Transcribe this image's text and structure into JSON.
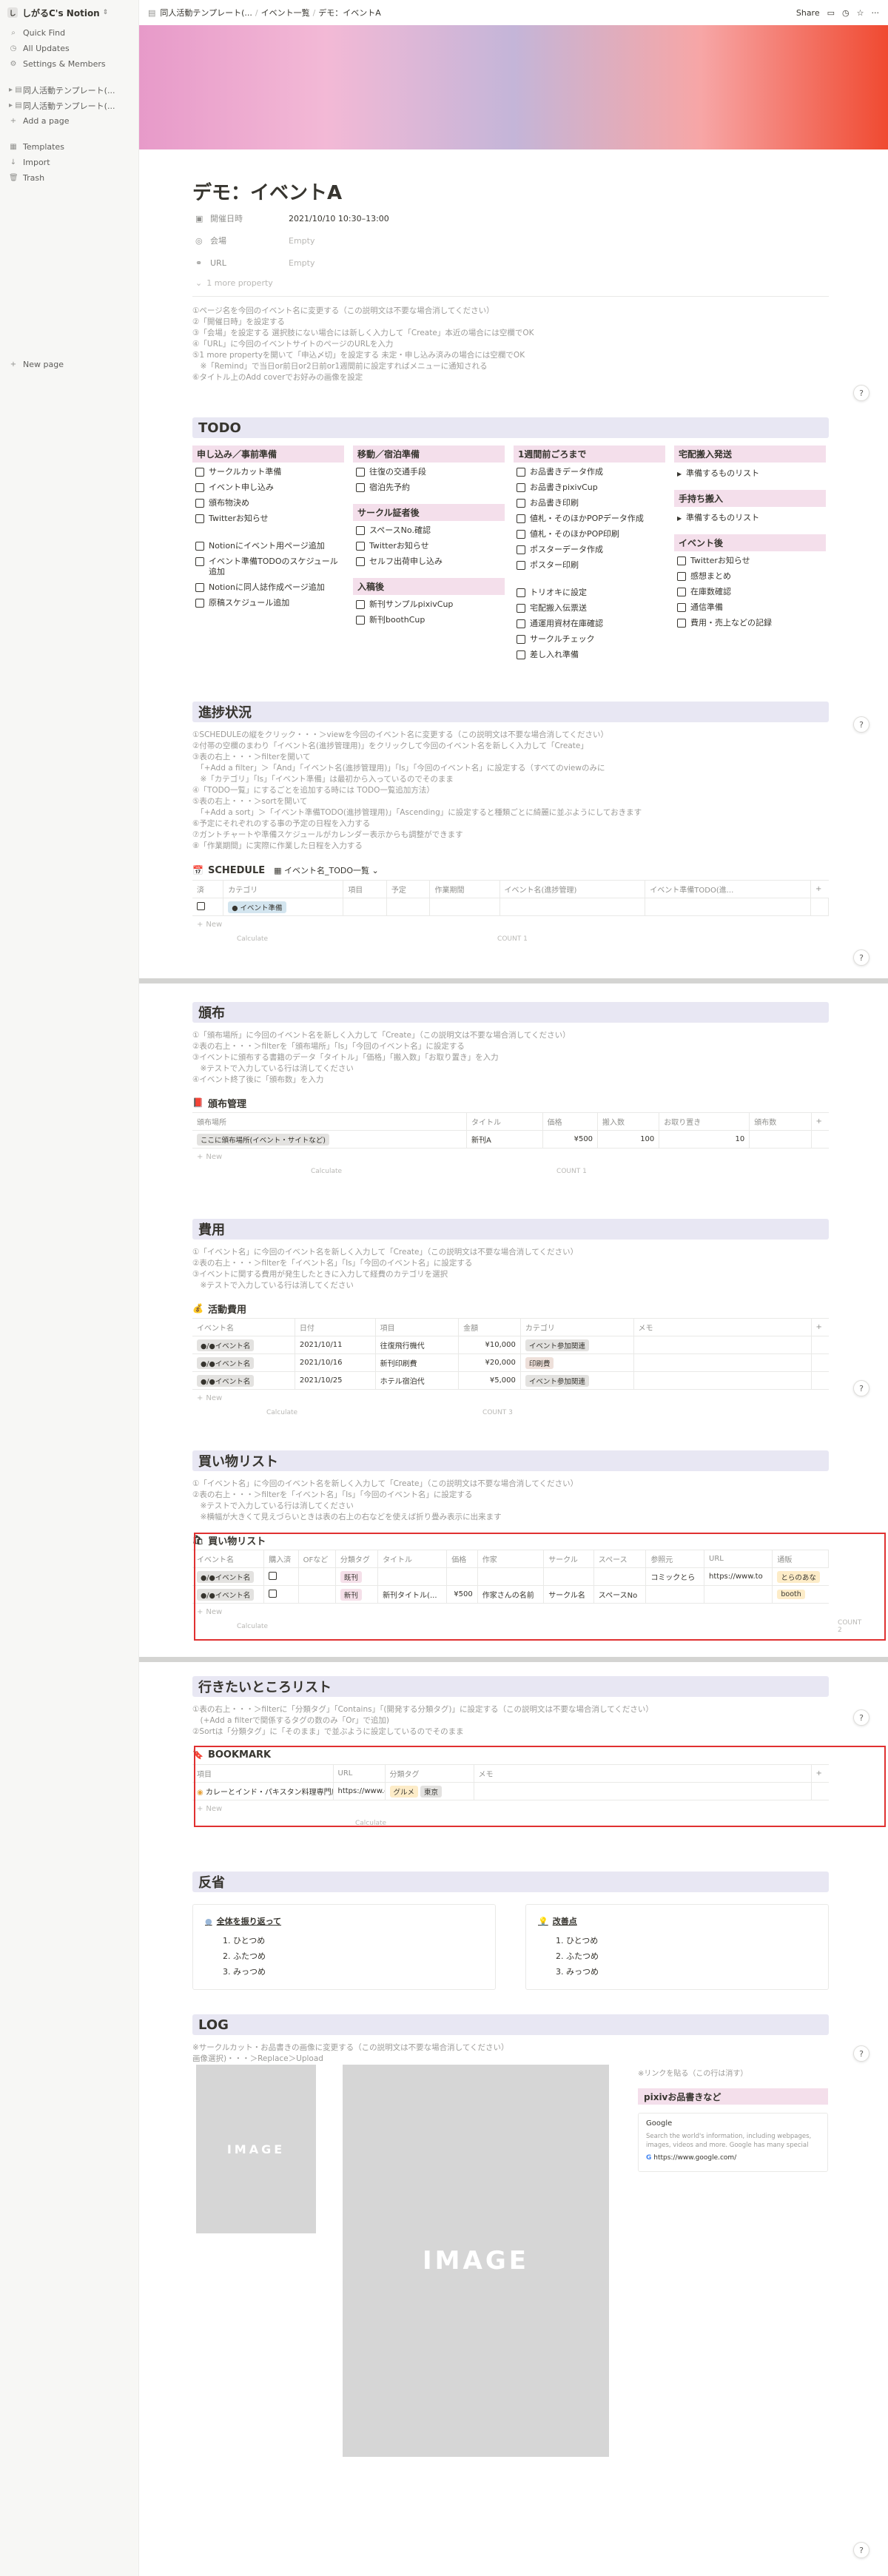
{
  "sidebar": {
    "workspace": "しがるC's Notion",
    "top_items": [
      {
        "icon": "search-icon",
        "glyph": "⌕",
        "label": "Quick Find"
      },
      {
        "icon": "clock-icon",
        "glyph": "◷",
        "label": "All Updates"
      },
      {
        "icon": "gear-icon",
        "glyph": "⚙",
        "label": "Settings & Members"
      }
    ],
    "pages": [
      {
        "label": "同人活動テンプレート(..."
      },
      {
        "label": "同人活動テンプレート(..."
      }
    ],
    "add_page": "Add a page",
    "bottom_items": [
      {
        "icon": "templates-icon",
        "glyph": "▦",
        "label": "Templates"
      },
      {
        "icon": "import-icon",
        "glyph": "↓",
        "label": "Import"
      },
      {
        "icon": "trash-icon",
        "glyph": "🗑",
        "label": "Trash"
      }
    ],
    "new_page": "New page"
  },
  "topbar": {
    "crumbs": [
      "同人活動テンプレート(...",
      "イベント一覧",
      "デモ：イベントA"
    ],
    "share": "Share"
  },
  "page": {
    "title": "デモ：イベントA",
    "properties": [
      {
        "icon": "calendar-icon",
        "glyph": "▣",
        "key": "開催日時",
        "value": "2021/10/10 10:30–13:00",
        "empty": false
      },
      {
        "icon": "location-icon",
        "glyph": "◎",
        "key": "会場",
        "value": "Empty",
        "empty": true
      },
      {
        "icon": "link-icon",
        "glyph": "⚭",
        "key": "URL",
        "value": "Empty",
        "empty": true
      }
    ],
    "more": "1 more property",
    "intro_notes": [
      "①ページ名を今回のイベント名に変更する（この説明文は不要な場合消してください）",
      "②「開催日時」を設定する",
      "③「会場」を設定する 選択肢にない場合には新しく入力して「Create」本近の場合には空欄でOK",
      "④「URL」に今回のイベントサイトのページのURLを入力",
      "⑤1 more propertyを開いて「申込〆切」を設定する 未定・申し込み済みの場合には空欄でOK",
      "　※「Remind」で当日or前日or2日前or1週間前に設定すればメニューに通知される",
      "⑥タイトル上のAdd coverでお好みの画像を設定"
    ]
  },
  "todo": {
    "heading": "TODO",
    "columns": [
      {
        "groups": [
          {
            "title": "申し込み／事前準備",
            "style": "pink",
            "items": [
              "サークルカット準備",
              "イベント申し込み",
              "頒布物決め",
              "Twitterお知らせ"
            ]
          },
          {
            "title": "",
            "style": "",
            "items": [
              "Notionにイベント用ページ追加",
              "イベント準備TODOのスケジュール追加",
              "Notionに同人誌作成ページ追加",
              "原稿スケジュール追加"
            ]
          }
        ]
      },
      {
        "groups": [
          {
            "title": "移動／宿泊準備",
            "style": "pink",
            "items": [
              "往復の交通手段",
              "宿泊先予約"
            ]
          },
          {
            "title": "サークル証者後",
            "style": "pink",
            "items": [
              "スペースNo.確認",
              "Twitterお知らせ",
              "セルフ出荷申し込み"
            ]
          },
          {
            "title": "入稿後",
            "style": "pink",
            "items": [
              "新刊サンプルpixivCup",
              "新刊boothCup"
            ]
          }
        ]
      },
      {
        "groups": [
          {
            "title": "1週間前ごろまで",
            "style": "pink",
            "items": [
              "お品書きデータ作成",
              "お品書きpixivCup",
              "お品書き印刷",
              "値札・そのほかPOPデータ作成",
              "値札・そのほかPOP印刷",
              "ポスターデータ作成",
              "ポスター印刷"
            ]
          },
          {
            "title": "",
            "style": "",
            "items": [
              "トリオキに設定",
              "宅配搬入伝票送",
              "通運用資材在庫確認",
              "サークルチェック",
              "差し入れ準備"
            ]
          }
        ]
      },
      {
        "groups": [
          {
            "title": "宅配搬入発送",
            "style": "pink",
            "toggles": [
              "準備するものリスト"
            ]
          },
          {
            "title": "手持ち搬入",
            "style": "pink",
            "toggles": [
              "準備するものリスト"
            ]
          },
          {
            "title": "イベント後",
            "style": "pink",
            "items": [
              "Twitterお知らせ",
              "感想まとめ",
              "在庫数確認",
              "通信準備",
              "費用・売上などの記録"
            ]
          }
        ]
      }
    ]
  },
  "progress": {
    "heading": "進捗状況",
    "notes": [
      "①SCHEDULEの縦をクリック・・・＞viewを今回のイベント名に変更する（この説明文は不要な場合消してください）",
      "②付帯の空欄のまわり「イベント名(進捗管理用)」をクリックして今回のイベント名を新しく入力して「Create」",
      "③表の右上・・・＞filterを開いて",
      "　「+Add a filter」＞「And」「イベント名(進捗管理用)」「Is」「今回のイベント名」に設定する（すべてのviewのみに",
      "　※「カテゴリ」「Is」「イベント準備」は最初から入っているのでそのまま",
      "④「TODO一覧」にするごとを追加する時には TODO一覧追加方法）",
      "⑤表の右上・・・＞sortを開いて",
      "　「+Add a sort」＞「イベント準備TODO(進捗管理用)」「Ascending」に設定すると種類ごとに綺麗に並ぶようにしておきます",
      "⑥予定にそれぞれのする事の予定の日程を入力する",
      "⑦ガントチャートや準備スケジュールがカレンダー表示からも調整ができます",
      "⑧「作業期間」に実際に作業した日程を入力する"
    ],
    "db_title": "SCHEDULE",
    "db_view": "イベント名_TODO一覧",
    "columns": [
      "済",
      "カテゴリ",
      "項目",
      "予定",
      "作業期間",
      "イベント名(進捗管理)",
      "イベント準備TODO(進..."
    ],
    "rows": [
      {
        "category": "イベント準備"
      }
    ],
    "new": "New",
    "calc": "Calculate",
    "count": "COUNT 1"
  },
  "distribution": {
    "heading": "頒布",
    "notes": [
      "①「頒布場所」に今回のイベント名を新しく入力して「Create」（この説明文は不要な場合消してください）",
      "②表の右上・・・＞filterを「頒布場所」「Is」「今回のイベント名」に設定する",
      "③イベントに頒布する書籍のデータ「タイトル」「価格」「搬入数」「お取り置き」を入力",
      "　※テストで入力している行は消してください",
      "④イベント終了後に「頒布数」を入力"
    ],
    "db_title": "頒布管理",
    "columns": [
      "頒布場所",
      "タイトル",
      "価格",
      "搬入数",
      "お取り置き",
      "頒布数"
    ],
    "rows": [
      {
        "place": "ここに頒布場所(イベント・サイトなど)",
        "title": "新刊A",
        "price": "¥500",
        "stock": "100",
        "reserved": "10",
        "sold": ""
      }
    ],
    "new": "New",
    "calc": "Calculate",
    "count": "COUNT 1"
  },
  "costs": {
    "heading": "費用",
    "notes": [
      "①「イベント名」に今回のイベント名を新しく入力して「Create」（この説明文は不要な場合消してください）",
      "②表の右上・・・＞filterを「イベント名」「Is」「今回のイベント名」に設定する",
      "③イベントに関する費用が発生したときに入力して経費のカテゴリを選択",
      "　※テストで入力している行は消してください"
    ],
    "db_title": "活動費用",
    "columns": [
      "イベント名",
      "日付",
      "項目",
      "金額",
      "カテゴリ",
      "メモ"
    ],
    "rows": [
      {
        "event": "●/●イベント名",
        "date": "2021/10/11",
        "item": "往復飛行機代",
        "amount": "¥10,000",
        "cat": "イベント参加関連",
        "cls": "gray"
      },
      {
        "event": "●/●イベント名",
        "date": "2021/10/16",
        "item": "新刊印刷費",
        "amount": "¥20,000",
        "cat": "印刷費",
        "cls": "brown"
      },
      {
        "event": "●/●イベント名",
        "date": "2021/10/25",
        "item": "ホテル宿泊代",
        "amount": "¥5,000",
        "cat": "イベント参加関連",
        "cls": "gray"
      }
    ],
    "new": "New",
    "calc": "Calculate",
    "count": "COUNT 3"
  },
  "shopping": {
    "heading": "買い物リスト",
    "notes": [
      "①「イベント名」に今回のイベント名を新しく入力して「Create」（この説明文は不要な場合消してください）",
      "②表の右上・・・＞filterを「イベント名」「Is」「今回のイベント名」に設定する",
      "　※テストで入力している行は消してください",
      "　※横幅が大きくて見えづらいときは表の右上の右などを使えば折り畳み表示に出来ます"
    ],
    "db_title": "買い物リスト",
    "columns": [
      "イベント名",
      "購入済",
      "OFなど",
      "分類タグ",
      "タイトル",
      "価格",
      "作家",
      "サークル",
      "スペース",
      "参照元",
      "URL",
      "通販"
    ],
    "rows": [
      {
        "event": "●/●イベント名",
        "of": "",
        "tag": "既刊",
        "tagcls": "pink",
        "title": "",
        "price": "",
        "artist": "",
        "circle": "",
        "space": "",
        "ref": "コミックとら",
        "url": "https://www.to",
        "shop": "とらのあな"
      },
      {
        "event": "●/●イベント名",
        "of": "",
        "tag": "新刊",
        "tagcls": "pink",
        "title": "新刊タイトル(...",
        "price": "¥500",
        "artist": "作家さんの名前",
        "circle": "サークル名",
        "space": "スペースNo",
        "ref": "",
        "url": "",
        "shop": "booth"
      }
    ],
    "new": "New",
    "calc": "Calculate",
    "count": "COUNT 2"
  },
  "places": {
    "heading": "行きたいところリスト",
    "notes": [
      "①表の右上・・・＞filterに「分類タグ」「Contains」「(開発する分類タグ)」に設定する（この説明文は不要な場合消してください）",
      "　(+Add a filterで関係するタグの数のみ「Or」で追加)",
      "②Sortは「分類タグ」に「そのまま」で並ぶように設定しているのでそのまま"
    ],
    "db_title": "BOOKMARK",
    "columns": [
      "項目",
      "URL",
      "分類タグ",
      "メモ"
    ],
    "rows": [
      {
        "item": "カレーとインド・パキスタン料理専門店 デリー",
        "url": "https://www.de",
        "tags": [
          "グルメ",
          "東京"
        ]
      }
    ],
    "new": "New",
    "calc": "Calculate"
  },
  "reflection": {
    "heading": "反省",
    "cards": [
      {
        "icon": "dot-icon",
        "title": "全体を振り返って",
        "items": [
          "ひとつめ",
          "ふたつめ",
          "みっつめ"
        ]
      },
      {
        "icon": "bulb-icon",
        "title": "改善点",
        "items": [
          "ひとつめ",
          "ふたつめ",
          "みっつめ"
        ]
      }
    ]
  },
  "log": {
    "heading": "LOG",
    "notes": [
      "※サークルカット・お品書きの画像に変更する（この説明文は不要な場合消してください）",
      "画像選択)・・・＞Replace＞Upload"
    ],
    "img_label": "IMAGE",
    "link_note": "※リンクを貼る（この行は消す）",
    "bm_heading": "pixivお品書きなど",
    "bm_title": "Google",
    "bm_desc": "Search the world's information, including webpages, images, videos and more. Google has many special",
    "bm_url": "https://www.google.com/"
  },
  "help": "?",
  "colors": {
    "section_bg": "#e8e7f3",
    "pink_head": "#f4dfeb",
    "red_highlight": "#e03131"
  }
}
